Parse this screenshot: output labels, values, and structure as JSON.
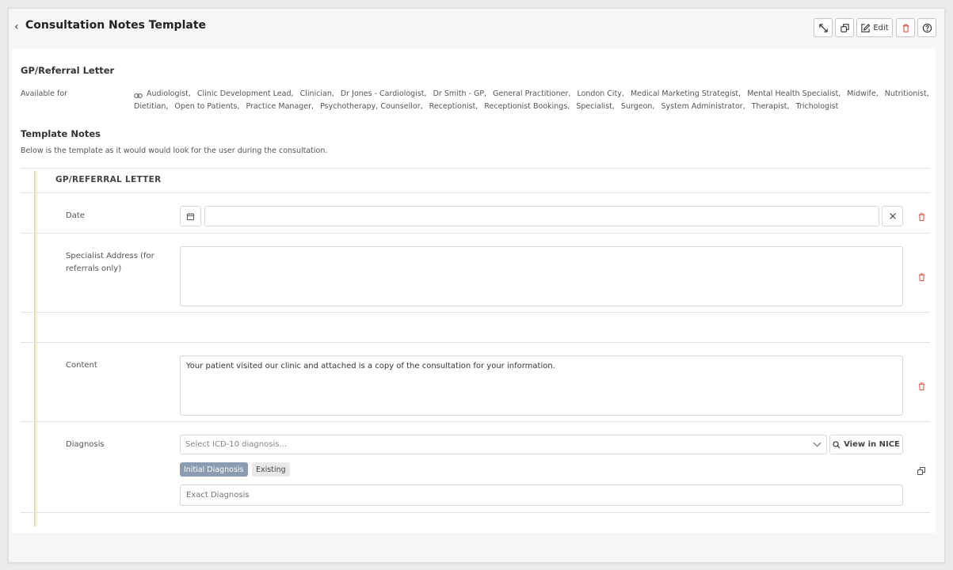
{
  "header": {
    "title": "Consultation Notes Template",
    "edit_label": "Edit"
  },
  "section": {
    "title": "GP/Referral Letter",
    "available_for_label": "Available for",
    "available_for": [
      "Audiologist",
      "Clinic Development Lead",
      "Clinician",
      "Dr Jones - Cardiologist",
      "Dr Smith - GP",
      "General Practitioner",
      "London City",
      "Medical Marketing Strategist",
      "Mental Health Specialist",
      "Midwife",
      "Nutritionist",
      "Dietitian",
      "Open to Patients",
      "Practice Manager",
      "Psychotherapy, Counsellor",
      "Receptionist",
      "Receptionist Bookings",
      "Specialist",
      "Surgeon",
      "System Administrator",
      "Therapist",
      "Trichologist"
    ]
  },
  "template_notes": {
    "title": "Template Notes",
    "description": "Below is the template as it would would look for the user during the consultation."
  },
  "form": {
    "heading": "GP/REFERRAL LETTER",
    "date_label": "Date",
    "date_value": "",
    "address_label": "Specialist Address (for referrals only)",
    "address_value": "",
    "content_label": "Content",
    "content_value": "Your patient visited our clinic and attached is a copy of the consultation for your information.",
    "diagnosis_label": "Diagnosis",
    "diagnosis_placeholder": "Select ICD-10 diagnosis...",
    "view_nice_label": "View in NICE",
    "chip_initial": "Initial Diagnosis",
    "chip_existing": "Existing",
    "exact_placeholder": "Exact Diagnosis"
  },
  "colors": {
    "accent_bar": "#e6dcae",
    "chip_active": "#8b9bb0",
    "danger": "#e05a4f"
  }
}
